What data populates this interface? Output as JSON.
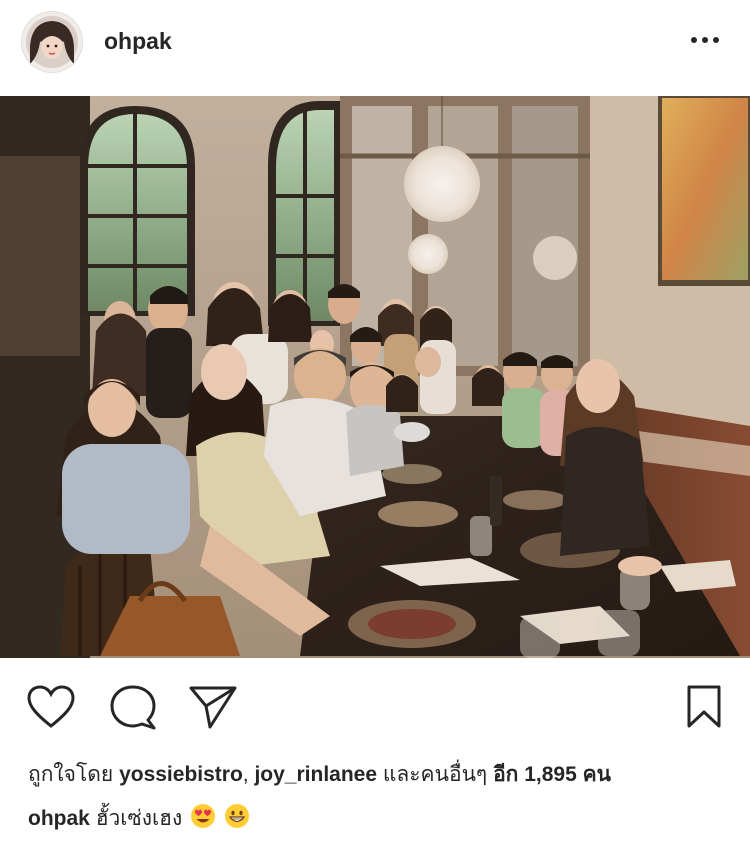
{
  "post": {
    "username": "ohpak",
    "image_alt": "Group photo of friends and family at a restaurant dinner table"
  },
  "icons": {
    "more": "more-horizontal-icon",
    "like": "heart-icon",
    "comment": "comment-icon",
    "share": "send-icon",
    "save": "bookmark-icon"
  },
  "likes": {
    "prefix": "ถูกใจโดย",
    "user1": "yossiebistro",
    "separator": ",",
    "user2": "joy_rinlanee",
    "and_others": "และคนอื่นๆ",
    "suffix": "อีก 1,895 คน"
  },
  "caption": {
    "username": "ohpak",
    "text": "ฮั้วเซ่งเฮง",
    "emojis": [
      "heart-eyes-emoji",
      "grinning-emoji"
    ]
  },
  "colors": {
    "text": "#262626",
    "border": "#dbdbdb"
  }
}
